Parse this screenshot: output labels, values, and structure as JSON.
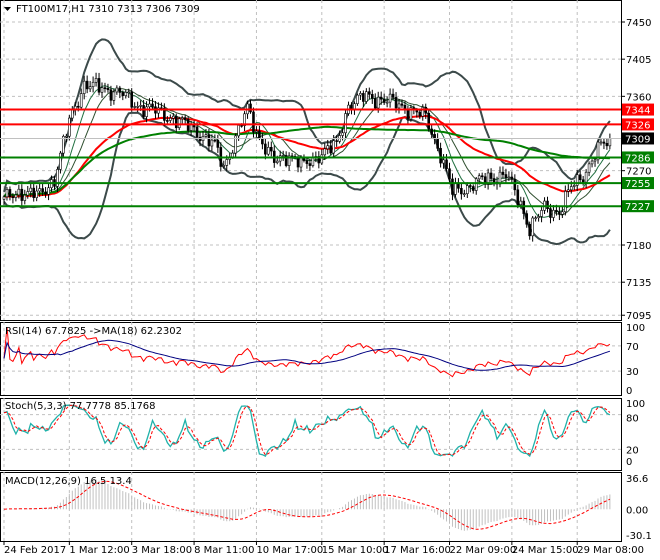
{
  "header": {
    "symbol_label": "FT100M17,H1",
    "ohlc": "7310 7313 7306 7309",
    "menu_icon": "triangle-down-icon"
  },
  "colors": {
    "bull": "#000000",
    "resistance": "#ff0000",
    "support": "#008000",
    "bands": "#3c4a4a",
    "ma_fast": "#ff0000",
    "ma_slow": "#008000",
    "rsi": "#ff0000",
    "rsi_ma": "#000080",
    "stoch_main": "#20b2aa",
    "stoch_signal": "#ff0000",
    "macd_hist": "#c0c0c0",
    "macd_signal": "#ff0000"
  },
  "chart_data": {
    "type": "candlestick",
    "title": "FT100M17,H1",
    "timeframe": "H1",
    "ylim": [
      7095,
      7475
    ],
    "price_ticks": [
      "7450",
      "7405",
      "7360",
      "7270",
      "7180",
      "7135",
      "7095"
    ],
    "price_path": [
      [
        0,
        7235
      ],
      [
        6,
        7245
      ],
      [
        12,
        7240
      ],
      [
        17,
        7260
      ],
      [
        22,
        7330
      ],
      [
        27,
        7375
      ],
      [
        32,
        7370
      ],
      [
        39,
        7365
      ],
      [
        44,
        7350
      ],
      [
        49,
        7345
      ],
      [
        56,
        7335
      ],
      [
        64,
        7320
      ],
      [
        71,
        7300
      ],
      [
        74,
        7275
      ],
      [
        77,
        7300
      ],
      [
        82,
        7345
      ],
      [
        86,
        7310
      ],
      [
        91,
        7280
      ],
      [
        96,
        7290
      ],
      [
        101,
        7275
      ],
      [
        106,
        7290
      ],
      [
        112,
        7300
      ],
      [
        116,
        7350
      ],
      [
        122,
        7360
      ],
      [
        129,
        7355
      ],
      [
        136,
        7345
      ],
      [
        142,
        7335
      ],
      [
        147,
        7290
      ],
      [
        151,
        7245
      ],
      [
        156,
        7250
      ],
      [
        162,
        7260
      ],
      [
        169,
        7265
      ],
      [
        174,
        7230
      ],
      [
        177,
        7200
      ],
      [
        182,
        7225
      ],
      [
        187,
        7220
      ],
      [
        191,
        7250
      ],
      [
        196,
        7270
      ],
      [
        201,
        7300
      ],
      [
        204,
        7309
      ]
    ],
    "levels": [
      {
        "price": 7344,
        "label": "7344",
        "kind": "resistance"
      },
      {
        "price": 7326,
        "label": "7326",
        "kind": "resistance"
      },
      {
        "price": 7286,
        "label": "7286",
        "kind": "support"
      },
      {
        "price": 7255,
        "label": "7255",
        "kind": "support"
      },
      {
        "price": 7227,
        "label": "7227",
        "kind": "support"
      }
    ],
    "current_price": {
      "price": 7309,
      "label": "7309"
    },
    "time_labels": [
      {
        "bar": 0,
        "label": "24 Feb 2017"
      },
      {
        "bar": 22,
        "label": "1 Mar 12:00"
      },
      {
        "bar": 43,
        "label": "3 Mar 18:00"
      },
      {
        "bar": 64,
        "label": "8 Mar 11:00"
      },
      {
        "bar": 85,
        "label": "10 Mar 17:00"
      },
      {
        "bar": 107,
        "label": "15 Mar 10:00"
      },
      {
        "bar": 128,
        "label": "17 Mar 16:00"
      },
      {
        "bar": 150,
        "label": "22 Mar 09:00"
      },
      {
        "bar": 171,
        "label": "24 Mar 15:00"
      },
      {
        "bar": 193,
        "label": "29 Mar 08:00"
      }
    ],
    "indicators": {
      "rsi": {
        "label": "RSI(14) 67.7825  ->MA(18) 62.2302",
        "ticks": [
          "100",
          "70",
          "30",
          "0"
        ],
        "ylim": [
          0,
          100
        ]
      },
      "stoch": {
        "label": "Stoch(5,3,3) 77.7778 85.1768",
        "ticks": [
          "100",
          "80",
          "20",
          "0"
        ],
        "ylim": [
          0,
          100
        ]
      },
      "macd": {
        "label": "MACD(12,26,9) 16.5 13.4",
        "ticks": [
          "36.6",
          "0.00",
          "-30.1"
        ],
        "ylim": [
          -30.1,
          36.6
        ]
      }
    }
  }
}
